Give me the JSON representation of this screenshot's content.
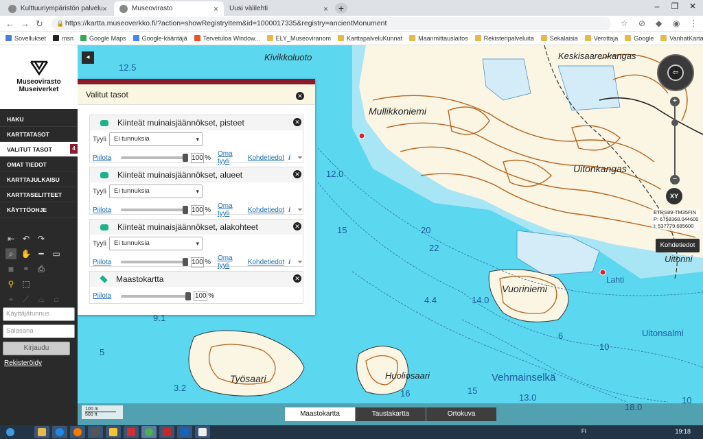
{
  "browser": {
    "tabs": [
      {
        "label": "Kulttuuriympäristön palveluikku",
        "active": false
      },
      {
        "label": "Museovirasto",
        "active": true
      },
      {
        "label": "Uusi välilehti",
        "active": false
      }
    ],
    "url": "https://kartta.museoverkko.fi/?action=showRegistryItem&id=1000017335&registry=ancientMonument",
    "bookmarks": [
      "Sovellukset",
      "msn",
      "Google Maps",
      "Google-kääntäjä",
      "Tervetuloa Window...",
      "ELY_Museoviranom",
      "KarttapalveluKunnat",
      "Maanmittauslaitos",
      "Rekisteripalveluita",
      "Sekalaisia",
      "Verottaja",
      "Google",
      "VanhatKartat"
    ]
  },
  "sidebar": {
    "logo_line1": "Museovirasto",
    "logo_line2": "Museiverket",
    "menu": [
      {
        "label": "HAKU"
      },
      {
        "label": "KARTTATASOT"
      },
      {
        "label": "VALITUT TASOT",
        "badge": "4",
        "selected": true
      },
      {
        "label": "OMAT TIEDOT"
      },
      {
        "label": "KARTTAJULKAISU"
      },
      {
        "label": "KARTTASELITTEET"
      },
      {
        "label": "KÄYTTÖOHJE"
      }
    ],
    "username_placeholder": "Käyttäjätunnus",
    "password_placeholder": "Salasana",
    "login_label": "Kirjaudu",
    "register_label": "Rekisteröidy"
  },
  "panel": {
    "title": "Valitut tasot",
    "style_label": "Tyyli",
    "hide_label": "Piilota",
    "own_style_label": "Oma tyyli",
    "features_label": "Kohdetiedot",
    "percent_sign": "%",
    "layers": [
      {
        "name": "Kiinteät muinaisjäännökset, pisteet",
        "style": "Ei tunnuksia",
        "opacity": "100"
      },
      {
        "name": "Kiinteät muinaisjäännökset, alueet",
        "style": "Ei tunnuksia",
        "opacity": "100"
      },
      {
        "name": "Kiinteät muinaisjäännökset, alakohteet",
        "style": "Ei tunnuksia",
        "opacity": "100"
      },
      {
        "name": "Maastokartta",
        "opacity": "100"
      }
    ]
  },
  "map": {
    "place_names": [
      "Kivikkoluoto",
      "Keskisaarenkangas",
      "Mullikkoniemi",
      "Uitonkangas",
      "Uitonni",
      "Vuoriniemi",
      "Lahti",
      "Uitonsalmi",
      "Työsaari",
      "Huoliosaari",
      "Vehmainselkä"
    ],
    "depths": [
      "12.5",
      "12.0",
      "15",
      "20",
      "22",
      "4.4",
      "14.0",
      "9.1",
      "13.0",
      "18.0",
      "15",
      "16",
      "10",
      "3.2",
      "5",
      "10",
      "6"
    ],
    "coords_system": "ETRS89-TM35FIN",
    "coords_p": "P: 6758368.044600",
    "coords_i": "I: 537779.685600",
    "xy_label": "XY",
    "features_button": "Kohdetiedot",
    "scale_m": "100 m",
    "scale_ft": "500 ft",
    "basemaps": [
      {
        "label": "Maastokartta",
        "selected": true
      },
      {
        "label": "Taustakartta",
        "selected": false
      },
      {
        "label": "Ortokuva",
        "selected": false
      }
    ]
  },
  "taskbar": {
    "time": "19:18",
    "lang": "FI"
  }
}
